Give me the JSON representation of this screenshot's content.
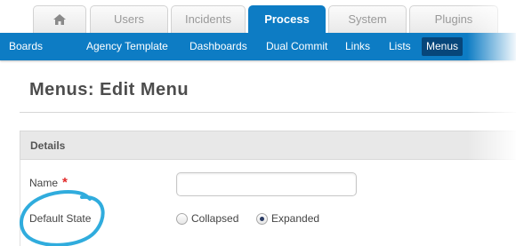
{
  "top_tabs": [
    {
      "label": "",
      "icon": "home-icon",
      "active": false
    },
    {
      "label": "Users",
      "active": false
    },
    {
      "label": "Incidents",
      "active": false
    },
    {
      "label": "Process",
      "active": true
    },
    {
      "label": "System",
      "active": false
    },
    {
      "label": "Plugins",
      "active": false
    }
  ],
  "sub_nav": [
    {
      "label": "Boards"
    },
    {
      "label": "Agency Template"
    },
    {
      "label": "Dashboards"
    },
    {
      "label": "Dual Commit"
    },
    {
      "label": "Links"
    },
    {
      "label": "Lists"
    },
    {
      "label": "Menus",
      "active": true
    }
  ],
  "page": {
    "title": "Menus: Edit Menu"
  },
  "details": {
    "heading": "Details",
    "name_label": "Name",
    "required_marker": "*",
    "name_value": "",
    "default_state_label": "Default State",
    "options": [
      {
        "label": "Collapsed",
        "checked": false
      },
      {
        "label": "Expanded",
        "checked": true
      }
    ]
  },
  "colors": {
    "brand_blue": "#0d7cc4",
    "active_subnav": "#07467a",
    "annotation_circle": "#1aa3d9",
    "required": "#e22a2a"
  }
}
